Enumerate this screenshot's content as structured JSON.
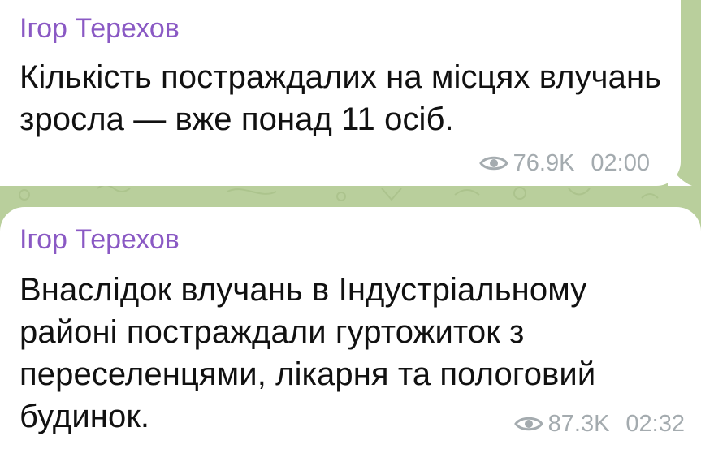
{
  "colors": {
    "background": "#b9cf9c",
    "bubble": "#ffffff",
    "sender": "#8a59c4",
    "text": "#111111",
    "meta": "#a4abaf"
  },
  "messages": [
    {
      "sender": "Ігор Терехов",
      "text": "Кількість постраждалих на місцях влучань зросла — вже понад 11 осіб.",
      "views_icon": "eye-icon",
      "views": "76.9K",
      "time": "02:00"
    },
    {
      "sender": "Ігор Терехов",
      "text": "Внаслідок влучань в Індустріальному районі постраждали гуртожиток з переселенцями, лікарня та пологовий будинок.",
      "views_icon": "eye-icon",
      "views": "87.3K",
      "time": "02:32"
    }
  ]
}
